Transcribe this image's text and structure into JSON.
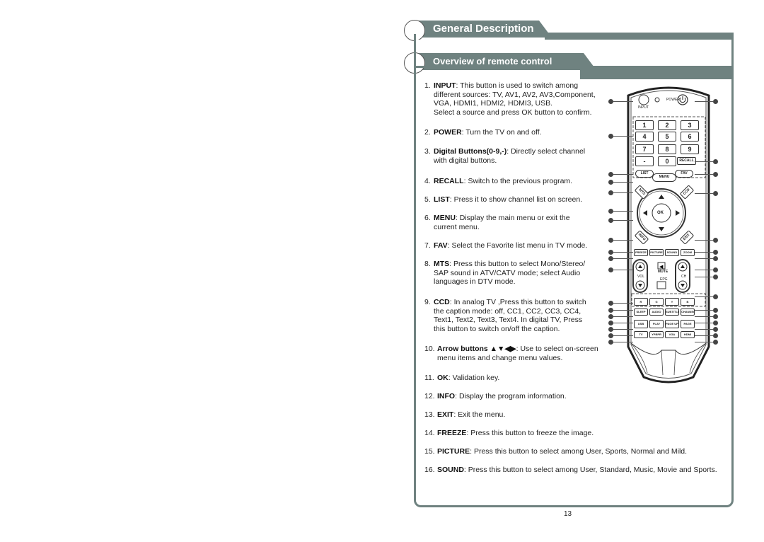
{
  "header": {
    "section_title": "General Description",
    "subsection_title": "Overview of remote control"
  },
  "items": [
    {
      "num": "1.",
      "key": "INPUT",
      "lines": [
        "This button is used to switch among",
        "different sources: TV, AV1, AV2, AV3,Component,",
        "VGA, HDMI1, HDMI2, HDMI3, USB.",
        "Select a source and press OK button to confirm."
      ]
    },
    {
      "num": "2.",
      "key": "POWER",
      "lines": [
        "Turn the TV on and off."
      ]
    },
    {
      "num": "3.",
      "key": "Digital Buttons(0-9,-)",
      "lines": [
        "Directly select channel",
        "with digital buttons."
      ]
    },
    {
      "num": "4.",
      "key": "RECALL",
      "lines": [
        "Switch to the previous program."
      ]
    },
    {
      "num": "5.",
      "key": "LIST",
      "lines": [
        "Press it to show channel list on screen."
      ]
    },
    {
      "num": "6.",
      "key": "MENU",
      "lines": [
        "Display the main menu or exit the",
        "current menu."
      ]
    },
    {
      "num": "7.",
      "key": "FAV",
      "lines": [
        "Select the Favorite list menu in TV mode."
      ]
    },
    {
      "num": "8.",
      "key": "MTS",
      "lines": [
        "Press this button to select Mono/Stereo/",
        "SAP sound in ATV/CATV mode; select Audio",
        "languages in DTV mode."
      ]
    },
    {
      "num": "9.",
      "key": "CCD",
      "lines": [
        "In analog TV ,Press this button to switch",
        "the caption mode: off, CC1, CC2, CC3, CC4,",
        "Text1, Text2, Text3, Text4. In digital TV, Press",
        "this button to switch on/off the caption."
      ]
    },
    {
      "num": "10.",
      "key": "Arrow buttons ▲▼◀▶",
      "lines": [
        "Use to select on-screen",
        "menu items and change menu values."
      ]
    },
    {
      "num": "11.",
      "key": "OK",
      "lines": [
        "Validation key."
      ]
    },
    {
      "num": "12.",
      "key": "INFO",
      "lines": [
        "Display the program information."
      ]
    },
    {
      "num": "13.",
      "key": "EXIT",
      "lines": [
        "Exit the menu."
      ]
    },
    {
      "num": "14.",
      "key": "FREEZE",
      "lines": [
        "Press this button to freeze the image."
      ]
    },
    {
      "num": "15.",
      "key": "PICTURE",
      "lines": [
        "Press this button to select among User, Sports, Normal and Mild."
      ]
    },
    {
      "num": "16.",
      "key": "SOUND",
      "lines": [
        "Press this button to select among User, Standard, Music, Movie and Sports."
      ]
    }
  ],
  "remote": {
    "input_label": "INPUT",
    "power_label": "POWER",
    "digits": [
      "1",
      "2",
      "3",
      "4",
      "5",
      "6",
      "7",
      "8",
      "9",
      "-",
      "0"
    ],
    "recall": "RECALL",
    "list": "LIST",
    "menu": "MENU",
    "fav": "FAV",
    "mts": "MTS",
    "ccd": "CCD",
    "ok": "OK",
    "info": "INFO",
    "exit": "EXIT",
    "func_row": [
      "FREEZE",
      "PICTURE",
      "SOUND",
      "ZOOM"
    ],
    "vol": "VOL",
    "ch": "CH",
    "mute": "MUTE",
    "epg": "EPG",
    "color_row": [
      "R",
      "G",
      "Y",
      "B"
    ],
    "row_a": [
      "SLEEP",
      "AUDIO",
      "SUBTITLE",
      "CHANNEL"
    ],
    "row_b": [
      "USB",
      "PLAY CONTROL",
      "PAGE UP",
      "PAGE DOWN"
    ],
    "row_c": [
      "TV",
      "YPBPR",
      "VGA",
      "HDMI"
    ]
  },
  "page_number": "13"
}
